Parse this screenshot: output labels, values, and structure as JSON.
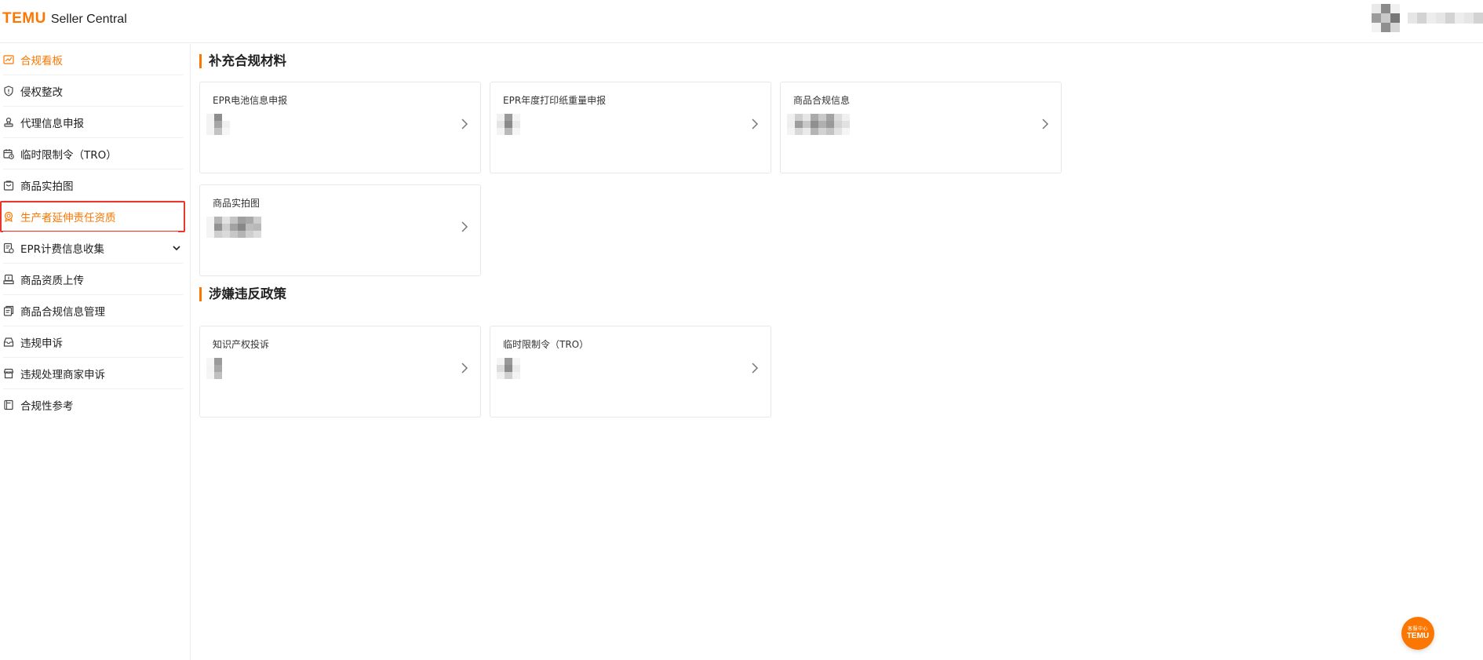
{
  "brand": {
    "logo": "TEMU",
    "product": "Seller Central",
    "accent": "#fb7701"
  },
  "header": {
    "avatar_colors": [
      "#d9d9d9",
      "#8e8e8e",
      "#eeeeee",
      "#8e8e8e",
      "#c4c4c4",
      "#7d7d7d",
      "#eeeeee",
      "#9a9a9a",
      "#d0d0d0"
    ]
  },
  "sidebar": {
    "items": [
      {
        "label": "合规看板",
        "icon": "chart-icon",
        "state": "active"
      },
      {
        "label": "侵权整改",
        "icon": "shield-alert-icon"
      },
      {
        "label": "代理信息申报",
        "icon": "stamp-icon"
      },
      {
        "label": "临时限制令（TRO）",
        "icon": "calendar-clock-icon"
      },
      {
        "label": "商品实拍图",
        "icon": "shopping-bag-icon"
      },
      {
        "label": "生产者延伸责任资质",
        "icon": "badge-icon",
        "state": "highlighted"
      },
      {
        "label": "EPR计费信息收集",
        "icon": "receipt-icon",
        "expandable": true
      },
      {
        "label": "商品资质上传",
        "icon": "upload-tray-icon"
      },
      {
        "label": "商品合规信息管理",
        "icon": "documents-icon"
      },
      {
        "label": "违规申诉",
        "icon": "inbox-icon"
      },
      {
        "label": "违规处理商家申诉",
        "icon": "store-icon"
      },
      {
        "label": "合规性参考",
        "icon": "book-icon"
      }
    ]
  },
  "sections": [
    {
      "title": "补充合规材料",
      "cards": [
        {
          "title": "EPR电池信息申报"
        },
        {
          "title": "EPR年度打印纸重量申报"
        },
        {
          "title": "商品合规信息"
        },
        {
          "title": "商品实拍图"
        }
      ]
    },
    {
      "title": "涉嫌违反政策",
      "cards": [
        {
          "title": "知识产权投诉"
        },
        {
          "title": "临时限制令（TRO）"
        }
      ]
    }
  ],
  "floating_button": {
    "top_text": "客服中心",
    "brand": "TEMU"
  }
}
